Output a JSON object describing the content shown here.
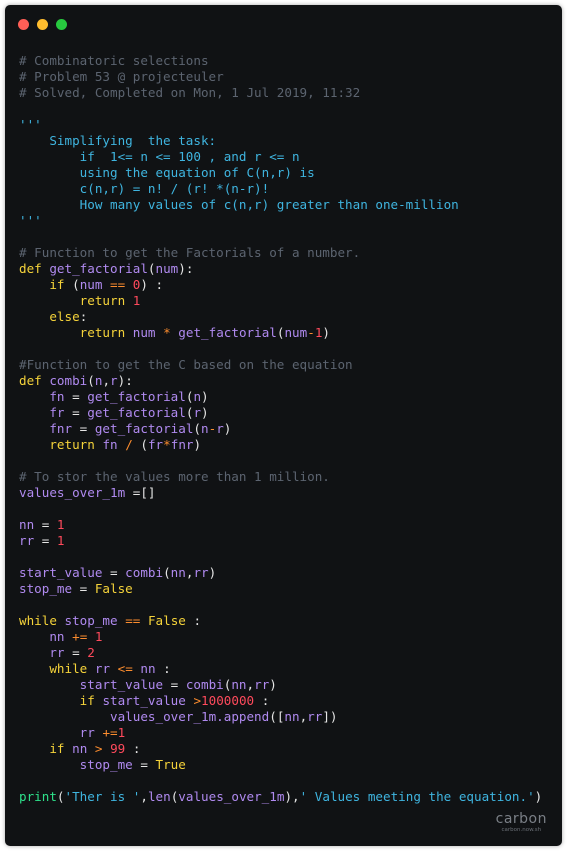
{
  "window": {
    "dot_colors": [
      "#ff5f56",
      "#ffbd2e",
      "#27c93f"
    ],
    "background": "#101214"
  },
  "palette": {
    "p": "#e6e6e6",
    "c": "#5c6470",
    "s": "#3fb5e0",
    "k": "#f5d33a",
    "f": "#b08af0",
    "n": "#ff4a5c",
    "o": "#fb8c2e",
    "g": "#2ee08a"
  },
  "code_lines": [
    [
      [
        "c",
        "# Combinatoric selections"
      ]
    ],
    [
      [
        "c",
        "# Problem 53 @ projecteuler"
      ]
    ],
    [
      [
        "c",
        "# Solved, Completed on Mon, 1 Jul 2019, 11:32"
      ]
    ],
    [],
    [
      [
        "s",
        "'''"
      ]
    ],
    [
      [
        "s",
        "    Simplifying  the task:"
      ]
    ],
    [
      [
        "s",
        "        if  1<= n <= 100 , and r <= n"
      ]
    ],
    [
      [
        "s",
        "        using the equation of C(n,r) is"
      ]
    ],
    [
      [
        "s",
        "        c(n,r) = n! / (r! *(n-r)!"
      ]
    ],
    [
      [
        "s",
        "        How many values of c(n,r) greater than one-million"
      ]
    ],
    [
      [
        "s",
        "'''"
      ]
    ],
    [],
    [
      [
        "c",
        "# Function to get the Factorials of a number."
      ]
    ],
    [
      [
        "k",
        "def "
      ],
      [
        "f",
        "get_factorial"
      ],
      [
        "p",
        "("
      ],
      [
        "f",
        "num"
      ],
      [
        "p",
        "):"
      ]
    ],
    [
      [
        "p",
        "    "
      ],
      [
        "k",
        "if"
      ],
      [
        "p",
        " ("
      ],
      [
        "f",
        "num"
      ],
      [
        "p",
        " "
      ],
      [
        "o",
        "=="
      ],
      [
        "p",
        " "
      ],
      [
        "n",
        "0"
      ],
      [
        "p",
        ") :"
      ]
    ],
    [
      [
        "p",
        "        "
      ],
      [
        "k",
        "return"
      ],
      [
        "p",
        " "
      ],
      [
        "n",
        "1"
      ]
    ],
    [
      [
        "p",
        "    "
      ],
      [
        "k",
        "else"
      ],
      [
        "p",
        ":"
      ]
    ],
    [
      [
        "p",
        "        "
      ],
      [
        "k",
        "return"
      ],
      [
        "p",
        " "
      ],
      [
        "f",
        "num"
      ],
      [
        "p",
        " "
      ],
      [
        "o",
        "*"
      ],
      [
        "p",
        " "
      ],
      [
        "f",
        "get_factorial"
      ],
      [
        "p",
        "("
      ],
      [
        "f",
        "num"
      ],
      [
        "o",
        "-"
      ],
      [
        "n",
        "1"
      ],
      [
        "p",
        ")"
      ]
    ],
    [],
    [
      [
        "c",
        "#Function to get the C based on the equation"
      ]
    ],
    [
      [
        "k",
        "def "
      ],
      [
        "f",
        "combi"
      ],
      [
        "p",
        "("
      ],
      [
        "f",
        "n"
      ],
      [
        "p",
        ","
      ],
      [
        "f",
        "r"
      ],
      [
        "p",
        "):"
      ]
    ],
    [
      [
        "p",
        "    "
      ],
      [
        "f",
        "fn"
      ],
      [
        "p",
        " = "
      ],
      [
        "f",
        "get_factorial"
      ],
      [
        "p",
        "("
      ],
      [
        "f",
        "n"
      ],
      [
        "p",
        ")"
      ]
    ],
    [
      [
        "p",
        "    "
      ],
      [
        "f",
        "fr"
      ],
      [
        "p",
        " = "
      ],
      [
        "f",
        "get_factorial"
      ],
      [
        "p",
        "("
      ],
      [
        "f",
        "r"
      ],
      [
        "p",
        ")"
      ]
    ],
    [
      [
        "p",
        "    "
      ],
      [
        "f",
        "fnr"
      ],
      [
        "p",
        " = "
      ],
      [
        "f",
        "get_factorial"
      ],
      [
        "p",
        "("
      ],
      [
        "f",
        "n"
      ],
      [
        "o",
        "-"
      ],
      [
        "f",
        "r"
      ],
      [
        "p",
        ")"
      ]
    ],
    [
      [
        "p",
        "    "
      ],
      [
        "k",
        "return"
      ],
      [
        "p",
        " "
      ],
      [
        "f",
        "fn"
      ],
      [
        "p",
        " "
      ],
      [
        "o",
        "/"
      ],
      [
        "p",
        " ("
      ],
      [
        "f",
        "fr"
      ],
      [
        "o",
        "*"
      ],
      [
        "f",
        "fnr"
      ],
      [
        "p",
        ")"
      ]
    ],
    [],
    [
      [
        "c",
        "# To stor the values more than 1 million."
      ]
    ],
    [
      [
        "f",
        "values_over_1m"
      ],
      [
        "p",
        " =[]"
      ]
    ],
    [],
    [
      [
        "f",
        "nn"
      ],
      [
        "p",
        " = "
      ],
      [
        "n",
        "1"
      ]
    ],
    [
      [
        "f",
        "rr"
      ],
      [
        "p",
        " = "
      ],
      [
        "n",
        "1"
      ]
    ],
    [],
    [
      [
        "f",
        "start_value"
      ],
      [
        "p",
        " = "
      ],
      [
        "f",
        "combi"
      ],
      [
        "p",
        "("
      ],
      [
        "f",
        "nn"
      ],
      [
        "p",
        ","
      ],
      [
        "f",
        "rr"
      ],
      [
        "p",
        ")"
      ]
    ],
    [
      [
        "f",
        "stop_me"
      ],
      [
        "p",
        " = "
      ],
      [
        "k",
        "False"
      ]
    ],
    [],
    [
      [
        "k",
        "while"
      ],
      [
        "p",
        " "
      ],
      [
        "f",
        "stop_me"
      ],
      [
        "p",
        " "
      ],
      [
        "o",
        "=="
      ],
      [
        "p",
        " "
      ],
      [
        "k",
        "False"
      ],
      [
        "p",
        " :"
      ]
    ],
    [
      [
        "p",
        "    "
      ],
      [
        "f",
        "nn"
      ],
      [
        "p",
        " "
      ],
      [
        "o",
        "+="
      ],
      [
        "p",
        " "
      ],
      [
        "n",
        "1"
      ]
    ],
    [
      [
        "p",
        "    "
      ],
      [
        "f",
        "rr"
      ],
      [
        "p",
        " = "
      ],
      [
        "n",
        "2"
      ]
    ],
    [
      [
        "p",
        "    "
      ],
      [
        "k",
        "while"
      ],
      [
        "p",
        " "
      ],
      [
        "f",
        "rr"
      ],
      [
        "p",
        " "
      ],
      [
        "o",
        "<="
      ],
      [
        "p",
        " "
      ],
      [
        "f",
        "nn"
      ],
      [
        "p",
        " :"
      ]
    ],
    [
      [
        "p",
        "        "
      ],
      [
        "f",
        "start_value"
      ],
      [
        "p",
        " = "
      ],
      [
        "f",
        "combi"
      ],
      [
        "p",
        "("
      ],
      [
        "f",
        "nn"
      ],
      [
        "p",
        ","
      ],
      [
        "f",
        "rr"
      ],
      [
        "p",
        ")"
      ]
    ],
    [
      [
        "p",
        "        "
      ],
      [
        "k",
        "if"
      ],
      [
        "p",
        " "
      ],
      [
        "f",
        "start_value"
      ],
      [
        "p",
        " "
      ],
      [
        "o",
        ">"
      ],
      [
        "n",
        "1000000"
      ],
      [
        "p",
        " :"
      ]
    ],
    [
      [
        "p",
        "            "
      ],
      [
        "f",
        "values_over_1m.append"
      ],
      [
        "p",
        "(["
      ],
      [
        "f",
        "nn"
      ],
      [
        "p",
        ","
      ],
      [
        "f",
        "rr"
      ],
      [
        "p",
        "])"
      ]
    ],
    [
      [
        "p",
        "        "
      ],
      [
        "f",
        "rr"
      ],
      [
        "p",
        " "
      ],
      [
        "o",
        "+="
      ],
      [
        "n",
        "1"
      ]
    ],
    [
      [
        "p",
        "    "
      ],
      [
        "k",
        "if"
      ],
      [
        "p",
        " "
      ],
      [
        "f",
        "nn"
      ],
      [
        "p",
        " "
      ],
      [
        "o",
        ">"
      ],
      [
        "p",
        " "
      ],
      [
        "n",
        "99"
      ],
      [
        "p",
        " :"
      ]
    ],
    [
      [
        "p",
        "        "
      ],
      [
        "f",
        "stop_me"
      ],
      [
        "p",
        " = "
      ],
      [
        "k",
        "True"
      ]
    ],
    [],
    [
      [
        "g",
        "print"
      ],
      [
        "p",
        "("
      ],
      [
        "s",
        "'Ther is '"
      ],
      [
        "p",
        ","
      ],
      [
        "f",
        "len"
      ],
      [
        "p",
        "("
      ],
      [
        "f",
        "values_over_1m"
      ],
      [
        "p",
        "),"
      ],
      [
        "s",
        "' Values meeting the equation.'"
      ],
      [
        "p",
        ")"
      ]
    ]
  ],
  "watermark": {
    "logo": "carbon",
    "url": "carbon.now.sh"
  }
}
